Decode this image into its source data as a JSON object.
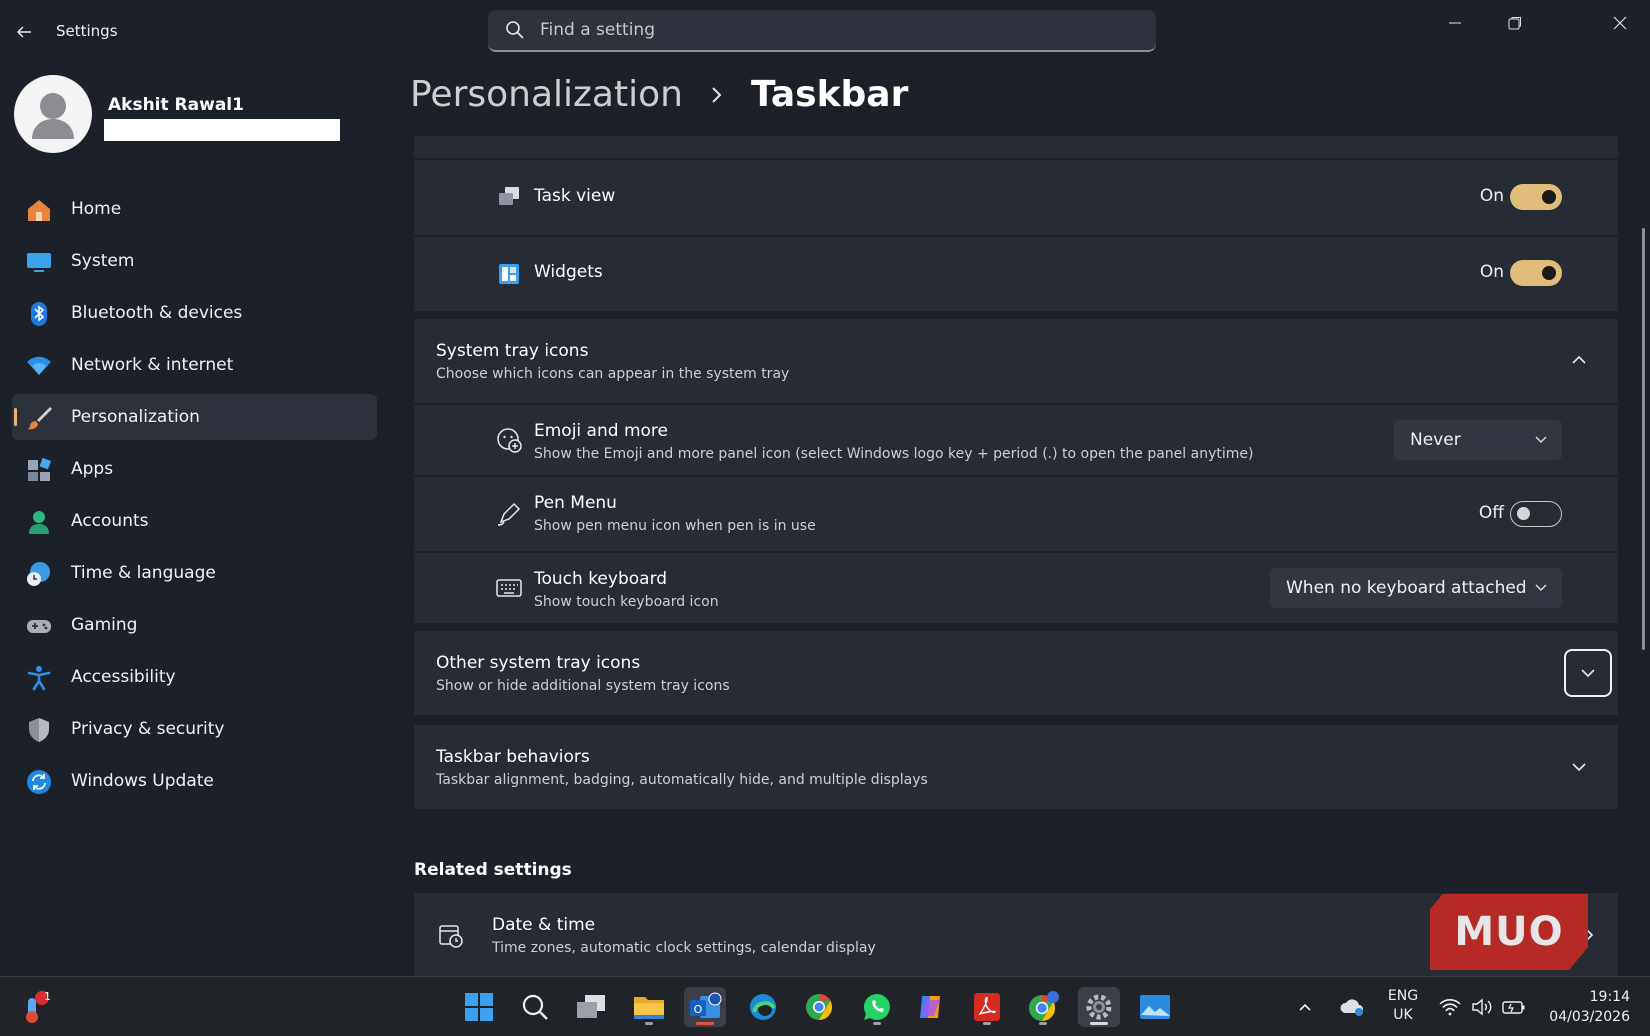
{
  "window": {
    "app_title": "Settings",
    "search_placeholder": "Find a setting"
  },
  "profile": {
    "name": "Akshit Rawal1"
  },
  "sidebar": {
    "items": [
      {
        "label": "Home",
        "icon": "home-icon"
      },
      {
        "label": "System",
        "icon": "system-icon"
      },
      {
        "label": "Bluetooth & devices",
        "icon": "bluetooth-icon"
      },
      {
        "label": "Network & internet",
        "icon": "wifi-icon"
      },
      {
        "label": "Personalization",
        "icon": "brush-icon",
        "active": true
      },
      {
        "label": "Apps",
        "icon": "apps-icon"
      },
      {
        "label": "Accounts",
        "icon": "accounts-icon"
      },
      {
        "label": "Time & language",
        "icon": "globe-clock-icon"
      },
      {
        "label": "Gaming",
        "icon": "gamepad-icon"
      },
      {
        "label": "Accessibility",
        "icon": "accessibility-icon"
      },
      {
        "label": "Privacy & security",
        "icon": "shield-icon"
      },
      {
        "label": "Windows Update",
        "icon": "update-icon"
      }
    ]
  },
  "header": {
    "parent": "Personalization",
    "current": "Taskbar"
  },
  "taskbar_items": [
    {
      "label": "Task view",
      "state": "On",
      "toggle": true
    },
    {
      "label": "Widgets",
      "state": "On",
      "toggle": true
    }
  ],
  "system_tray": {
    "title": "System tray icons",
    "subtitle": "Choose which icons can appear in the system tray",
    "items": [
      {
        "title": "Emoji and more",
        "subtitle": "Show the Emoji and more panel icon (select Windows logo key + period (.) to open the panel anytime)",
        "value": "Never"
      },
      {
        "title": "Pen Menu",
        "subtitle": "Show pen menu icon when pen is in use",
        "state": "Off",
        "toggle": false
      },
      {
        "title": "Touch keyboard",
        "subtitle": "Show touch keyboard icon",
        "value": "When no keyboard attached"
      }
    ]
  },
  "other_tray": {
    "title": "Other system tray icons",
    "subtitle": "Show or hide additional system tray icons"
  },
  "behaviors": {
    "title": "Taskbar behaviors",
    "subtitle": "Taskbar alignment, badging, automatically hide, and multiple displays"
  },
  "related": {
    "heading": "Related settings",
    "items": [
      {
        "title": "Date & time",
        "subtitle": "Time zones, automatic clock settings, calendar display"
      }
    ]
  },
  "watermark": "MUO",
  "system_taskbar": {
    "notification_count": "1",
    "lang_line1": "ENG",
    "lang_line2": "UK",
    "time": "19:14",
    "date": "04/03/2026"
  },
  "colors": {
    "accent": "#e0bd7a",
    "background": "#1c2029",
    "panel": "#262b34"
  }
}
